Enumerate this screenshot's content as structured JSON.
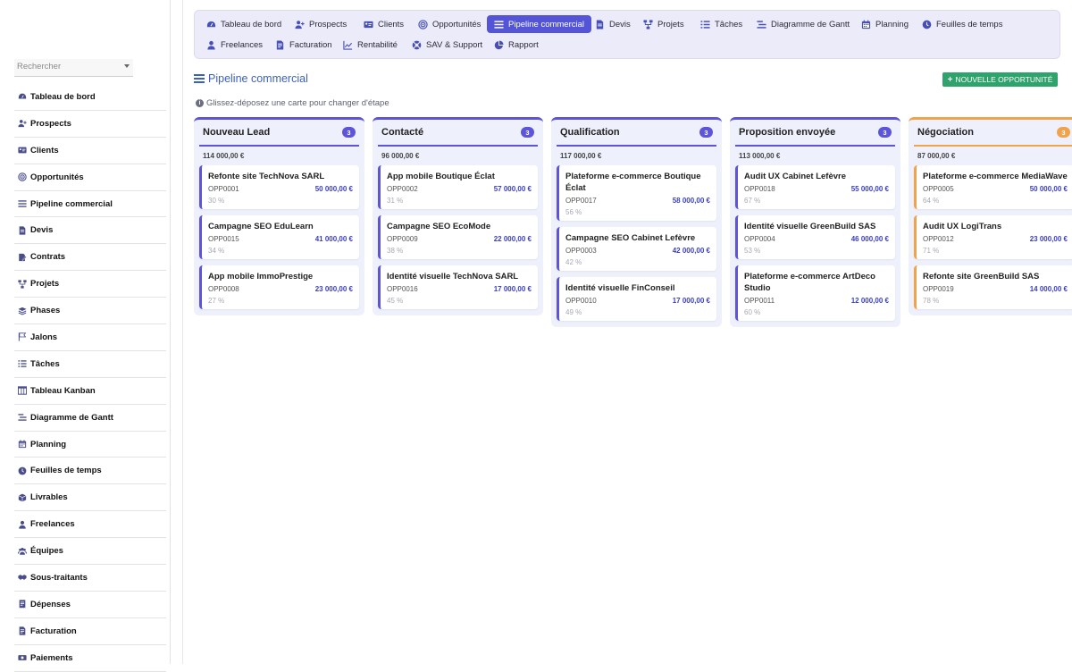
{
  "sidebar": {
    "search_placeholder": "Rechercher",
    "items": [
      {
        "label": "Tableau de bord",
        "icon": "dashboard-icon"
      },
      {
        "label": "Prospects",
        "icon": "user-plus-icon"
      },
      {
        "label": "Clients",
        "icon": "id-card-icon"
      },
      {
        "label": "Opportunités",
        "icon": "target-icon"
      },
      {
        "label": "Pipeline commercial",
        "icon": "bars-icon"
      },
      {
        "label": "Devis",
        "icon": "document-icon"
      },
      {
        "label": "Contrats",
        "icon": "contract-icon"
      },
      {
        "label": "Projets",
        "icon": "project-tree-icon"
      },
      {
        "label": "Phases",
        "icon": "layers-icon"
      },
      {
        "label": "Jalons",
        "icon": "flag-icon"
      },
      {
        "label": "Tâches",
        "icon": "task-list-icon"
      },
      {
        "label": "Tableau Kanban",
        "icon": "kanban-icon"
      },
      {
        "label": "Diagramme de Gantt",
        "icon": "gantt-icon"
      },
      {
        "label": "Planning",
        "icon": "calendar-icon"
      },
      {
        "label": "Feuilles de temps",
        "icon": "clock-icon"
      },
      {
        "label": "Livrables",
        "icon": "box-icon"
      },
      {
        "label": "Freelances",
        "icon": "user-icon"
      },
      {
        "label": "Équipes",
        "icon": "team-icon"
      },
      {
        "label": "Sous-traitants",
        "icon": "handshake-icon"
      },
      {
        "label": "Dépenses",
        "icon": "receipt-icon"
      },
      {
        "label": "Facturation",
        "icon": "invoice-icon"
      },
      {
        "label": "Paiements",
        "icon": "money-icon"
      }
    ]
  },
  "topnav": {
    "row1": [
      {
        "label": "Tableau de bord",
        "icon": "dashboard-icon"
      },
      {
        "label": "Prospects",
        "icon": "user-plus-icon"
      },
      {
        "label": "Clients",
        "icon": "id-card-icon"
      },
      {
        "label": "Opportunités",
        "icon": "target-icon"
      },
      {
        "label": "Pipeline commercial",
        "icon": "bars-icon",
        "active": true
      },
      {
        "label": "Devis",
        "icon": "document-icon"
      },
      {
        "label": "Projets",
        "icon": "project-tree-icon"
      },
      {
        "label": "Tâches",
        "icon": "task-list-icon"
      },
      {
        "label": "Diagramme de Gantt",
        "icon": "gantt-icon"
      },
      {
        "label": "Planning",
        "icon": "calendar-icon"
      },
      {
        "label": "Feuilles de temps",
        "icon": "clock-icon"
      }
    ],
    "row2": [
      {
        "label": "Freelances",
        "icon": "user-icon"
      },
      {
        "label": "Facturation",
        "icon": "invoice-icon"
      },
      {
        "label": "Rentabilité",
        "icon": "chart-icon"
      },
      {
        "label": "SAV & Support",
        "icon": "lifebuoy-icon"
      },
      {
        "label": "Rapport",
        "icon": "pie-icon"
      }
    ]
  },
  "header": {
    "title": "Pipeline commercial",
    "new_button": "NOUVELLE OPPORTUNITÉ",
    "hint": "Glissez-déposez une carte pour changer d'étape"
  },
  "colors": {
    "accent": "#5355d6",
    "stage_purple": "#5c55d9",
    "stage_orange": "#f0a34c",
    "success": "#2ea36b",
    "amount": "#3a3fc0"
  },
  "columns": [
    {
      "title": "Nouveau Lead",
      "count": "3",
      "total": "114 000,00 €",
      "cards": [
        {
          "title": "Refonte site TechNova SARL",
          "ref": "OPP0001",
          "amount": "50 000,00 €",
          "prob": "30 %"
        },
        {
          "title": "Campagne SEO EduLearn",
          "ref": "OPP0015",
          "amount": "41 000,00 €",
          "prob": "34 %"
        },
        {
          "title": "App mobile ImmoPrestige",
          "ref": "OPP0008",
          "amount": "23 000,00 €",
          "prob": "27 %"
        }
      ]
    },
    {
      "title": "Contacté",
      "count": "3",
      "total": "96 000,00 €",
      "cards": [
        {
          "title": "App mobile Boutique Éclat",
          "ref": "OPP0002",
          "amount": "57 000,00 €",
          "prob": "31 %"
        },
        {
          "title": "Campagne SEO EcoMode",
          "ref": "OPP0009",
          "amount": "22 000,00 €",
          "prob": "38 %"
        },
        {
          "title": "Identité visuelle TechNova SARL",
          "ref": "OPP0016",
          "amount": "17 000,00 €",
          "prob": "45 %"
        }
      ]
    },
    {
      "title": "Qualification",
      "count": "3",
      "total": "117 000,00 €",
      "cards": [
        {
          "title": "Plateforme e-commerce Boutique Éclat",
          "ref": "OPP0017",
          "amount": "58 000,00 €",
          "prob": "56 %"
        },
        {
          "title": "Campagne SEO Cabinet Lefèvre",
          "ref": "OPP0003",
          "amount": "42 000,00 €",
          "prob": "42 %"
        },
        {
          "title": "Identité visuelle FinConseil",
          "ref": "OPP0010",
          "amount": "17 000,00 €",
          "prob": "49 %"
        }
      ]
    },
    {
      "title": "Proposition envoyée",
      "count": "3",
      "total": "113 000,00 €",
      "cards": [
        {
          "title": "Audit UX Cabinet Lefèvre",
          "ref": "OPP0018",
          "amount": "55 000,00 €",
          "prob": "67 %"
        },
        {
          "title": "Identité visuelle GreenBuild SAS",
          "ref": "OPP0004",
          "amount": "46 000,00 €",
          "prob": "53 %"
        },
        {
          "title": "Plateforme e-commerce ArtDeco Studio",
          "ref": "OPP0011",
          "amount": "12 000,00 €",
          "prob": "60 %"
        }
      ]
    },
    {
      "title": "Négociation",
      "count": "3",
      "total": "87 000,00 €",
      "orange": true,
      "cards": [
        {
          "title": "Plateforme e-commerce MediaWave",
          "ref": "OPP0005",
          "amount": "50 000,00 €",
          "prob": "64 %"
        },
        {
          "title": "Audit UX LogiTrans",
          "ref": "OPP0012",
          "amount": "23 000,00 €",
          "prob": "71 %"
        },
        {
          "title": "Refonte site GreenBuild SAS",
          "ref": "OPP0019",
          "amount": "14 000,00 €",
          "prob": "78 %"
        }
      ]
    }
  ]
}
